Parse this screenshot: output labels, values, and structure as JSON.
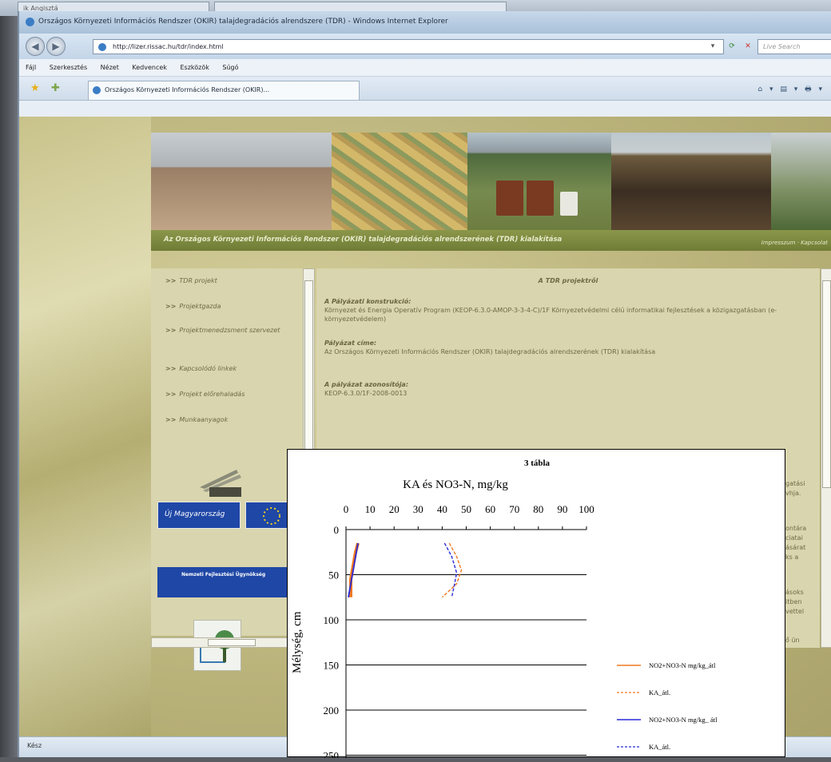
{
  "background_tabs": [
    "ik Angisztá"
  ],
  "window": {
    "title": "Országos Környezeti Információs Rendszer (OKIR) talajdegradációs alrendszere (TDR) - Windows Internet Explorer",
    "url": "http://lizer.rissac.hu/tdr/index.html",
    "search_placeholder": "Live Search",
    "menu": [
      "Fájl",
      "Szerkesztés",
      "Nézet",
      "Kedvencek",
      "Eszközök",
      "Súgó"
    ],
    "tab_label": "Országos Környezeti Információs Rendszer (OKIR)...",
    "status": "Kész"
  },
  "site": {
    "banner_text": "Az Országos Környezeti Információs Rendszer (OKIR) talajdegradációs alrendszerének (TDR) kialakítása",
    "banner_right": "Impresszum · Kapcsolat",
    "nav": [
      "TDR projekt",
      "Projektgazda",
      "Projektmenedzsment szervezet",
      "Kapcsolódó linkek",
      "Projekt előrehaladás",
      "Munkaanyagok"
    ],
    "nav_prefix": ">>",
    "logo_text": "Új Magyarország",
    "contact_title": "Nemzeti Fejlesztési Ügynökség",
    "main_title": "A TDR projektről",
    "sections": [
      {
        "heading": "A Pályázati konstrukció:",
        "body": "Környezet és Energia Operatív Program (KEOP-6.3.0-AMOP-3-3-4-C)/1F Környezetvédelmi célú informatikai fejlesztések a közigazgatásban (e-környezetvédelem)"
      },
      {
        "heading": "Pályázat címe:",
        "body": "Az Országos Környezeti Információs Rendszer (OKIR) talajdegradációs alrendszerének (TDR) kialakítása"
      },
      {
        "heading": "A pályázat azonosítója:",
        "body": "KEOP-6.3.0/1F-2008-0013"
      }
    ],
    "right_fragments": [
      "gatási",
      "vhja.",
      "ontára",
      "ciatai",
      "ásárat",
      "ks a",
      "ásoks",
      "itben",
      "vettel",
      "ő ün"
    ]
  },
  "chart_data": {
    "type": "line",
    "title": "3 tábla",
    "subtitle": "KA és NO3-N, mg/kg",
    "ylabel": "Mélység, cm",
    "xlim": [
      0,
      100
    ],
    "ylim": [
      0,
      250
    ],
    "x_ticks": [
      0,
      10,
      20,
      30,
      40,
      50,
      60,
      70,
      80,
      90,
      100
    ],
    "y_ticks": [
      0,
      50,
      100,
      150,
      200,
      250
    ],
    "y_reversed": true,
    "grid": "horizontal",
    "legend_position": "right",
    "series": [
      {
        "name": "NO2+NO3-N mg/kg_átl",
        "color": "#f07820",
        "style": "solid",
        "points": [
          [
            5,
            15
          ],
          [
            4,
            25
          ],
          [
            3,
            40
          ],
          [
            2,
            55
          ],
          [
            2,
            75
          ]
        ]
      },
      {
        "name": "KA_átl.",
        "color": "#f07820",
        "style": "dashed",
        "points": [
          [
            43,
            15
          ],
          [
            46,
            30
          ],
          [
            48,
            45
          ],
          [
            46,
            60
          ],
          [
            40,
            75
          ]
        ]
      },
      {
        "name": "NO2+NO3-N mg/kg_ átl",
        "color": "#2a2ad8",
        "style": "solid",
        "points": [
          [
            5,
            15
          ],
          [
            3,
            45
          ],
          [
            1,
            75
          ]
        ]
      },
      {
        "name": "KA_átl.",
        "color": "#2a2ad8",
        "style": "dashed",
        "points": [
          [
            41,
            15
          ],
          [
            44,
            30
          ],
          [
            46,
            48
          ],
          [
            45,
            62
          ],
          [
            44,
            75
          ]
        ]
      }
    ]
  }
}
